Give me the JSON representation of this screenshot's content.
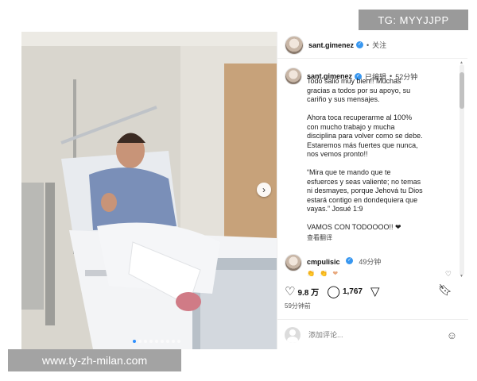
{
  "watermark_top": "TG: MYYJJPP",
  "watermark_bottom": "www.ty-zh-milan.com",
  "post": {
    "header": {
      "username": "sant.gimenez",
      "verified_icon": "verified-badge-icon",
      "separator": "•",
      "follow_label": "关注"
    },
    "caption": {
      "username": "sant.gimenez",
      "edited_label": "已编辑",
      "time": "52分钟",
      "text": "Todo salió muy bien!! Muchas\ngracias a todos por su apoyo, su\ncariño y sus mensajes.\n\nAhora toca recuperarme al 100%\ncon mucho trabajo y mucha\ndisciplina para volver como se debe.\nEstaremos más fuertes que nunca,\nnos vemos pronto!!\n\n“Mira que te mando que te\nesfuerces y seas valiente; no temas\nni desmayes, porque Jehová tu Dios\nestará contigo en dondequiera que\nvayas.” Josué 1:9\n\nVAMOS CON TODOOOO!! ❤",
      "translate_label": "查看翻译"
    },
    "comment": {
      "username": "cmpulisic",
      "time": "49分钟",
      "text": "👏 👏 ❤"
    },
    "actions": {
      "likes": "9.8 万",
      "comments": "1,767",
      "like_icon": "heart-icon",
      "comment_icon": "comment-icon",
      "share_icon": "send-icon",
      "save_icon": "bookmark-icon"
    },
    "time_ago": "59分钟前",
    "add_comment": {
      "placeholder": "添加评论...",
      "emoji_icon": "smiley-icon"
    },
    "carousel": {
      "next_icon": "chevron-right-icon",
      "slide_count": 9,
      "active_slide": 1
    }
  }
}
